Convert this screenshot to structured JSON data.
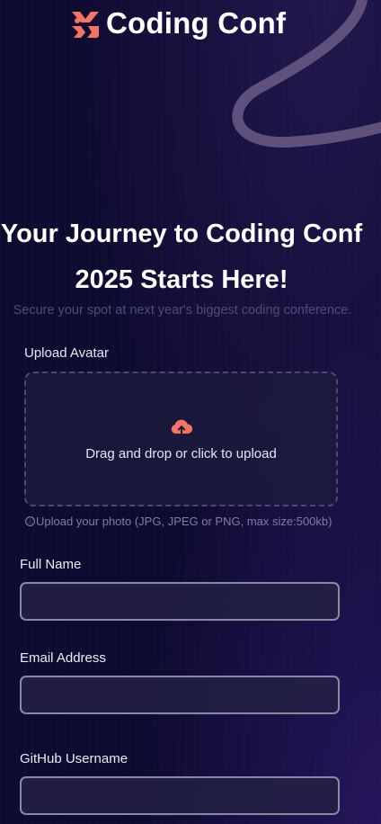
{
  "brand": {
    "name": "Coding Conf",
    "accent_color": "#f57462",
    "logo_icon": "coding-conf-logo-icon"
  },
  "hero": {
    "title_line1": "Your Journey to Coding Conf",
    "title_line2": "2025 Starts Here!",
    "subtitle": "Secure your spot at next year's biggest coding conference."
  },
  "avatar_upload": {
    "label": "Upload Avatar",
    "dropzone_text": "Drag and drop or click to upload",
    "icon": "cloud-upload-icon",
    "hint_icon": "ⓘ",
    "hint": "Upload your photo (JPG, JPEG or PNG, max size:500kb)"
  },
  "form": {
    "full_name": {
      "label": "Full Name",
      "value": "",
      "placeholder": ""
    },
    "email": {
      "label": "Email Address",
      "value": "",
      "placeholder": ""
    },
    "github": {
      "label": "GitHub Username",
      "value": "",
      "placeholder": ""
    }
  },
  "colors": {
    "background": "#0e0b31",
    "input_border": "#8a89a6",
    "muted_text": "#7f7da2"
  }
}
